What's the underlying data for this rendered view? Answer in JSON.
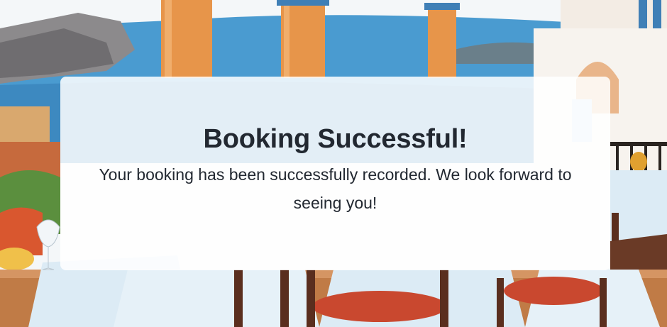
{
  "confirmation": {
    "title": "Booking Successful!",
    "message": "Your booking has been successfully recorded. We look forward to seeing you!"
  },
  "colors": {
    "card_background": "#ffffff",
    "text": "#222831",
    "sea": "#4a9bd0",
    "column": "#e7954a",
    "tablecloth": "#dcebf5",
    "chair_cushion": "#c9482f",
    "chair_wood": "#5a2e1e"
  }
}
